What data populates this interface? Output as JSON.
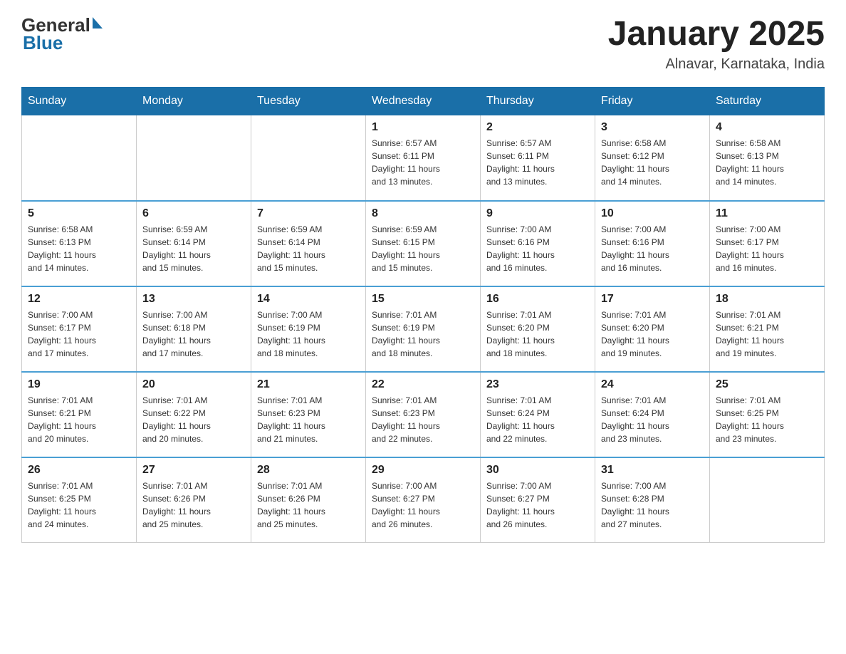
{
  "header": {
    "logo_general": "General",
    "logo_blue": "Blue",
    "title": "January 2025",
    "subtitle": "Alnavar, Karnataka, India"
  },
  "weekdays": [
    "Sunday",
    "Monday",
    "Tuesday",
    "Wednesday",
    "Thursday",
    "Friday",
    "Saturday"
  ],
  "weeks": [
    [
      {
        "day": "",
        "info": ""
      },
      {
        "day": "",
        "info": ""
      },
      {
        "day": "",
        "info": ""
      },
      {
        "day": "1",
        "info": "Sunrise: 6:57 AM\nSunset: 6:11 PM\nDaylight: 11 hours\nand 13 minutes."
      },
      {
        "day": "2",
        "info": "Sunrise: 6:57 AM\nSunset: 6:11 PM\nDaylight: 11 hours\nand 13 minutes."
      },
      {
        "day": "3",
        "info": "Sunrise: 6:58 AM\nSunset: 6:12 PM\nDaylight: 11 hours\nand 14 minutes."
      },
      {
        "day": "4",
        "info": "Sunrise: 6:58 AM\nSunset: 6:13 PM\nDaylight: 11 hours\nand 14 minutes."
      }
    ],
    [
      {
        "day": "5",
        "info": "Sunrise: 6:58 AM\nSunset: 6:13 PM\nDaylight: 11 hours\nand 14 minutes."
      },
      {
        "day": "6",
        "info": "Sunrise: 6:59 AM\nSunset: 6:14 PM\nDaylight: 11 hours\nand 15 minutes."
      },
      {
        "day": "7",
        "info": "Sunrise: 6:59 AM\nSunset: 6:14 PM\nDaylight: 11 hours\nand 15 minutes."
      },
      {
        "day": "8",
        "info": "Sunrise: 6:59 AM\nSunset: 6:15 PM\nDaylight: 11 hours\nand 15 minutes."
      },
      {
        "day": "9",
        "info": "Sunrise: 7:00 AM\nSunset: 6:16 PM\nDaylight: 11 hours\nand 16 minutes."
      },
      {
        "day": "10",
        "info": "Sunrise: 7:00 AM\nSunset: 6:16 PM\nDaylight: 11 hours\nand 16 minutes."
      },
      {
        "day": "11",
        "info": "Sunrise: 7:00 AM\nSunset: 6:17 PM\nDaylight: 11 hours\nand 16 minutes."
      }
    ],
    [
      {
        "day": "12",
        "info": "Sunrise: 7:00 AM\nSunset: 6:17 PM\nDaylight: 11 hours\nand 17 minutes."
      },
      {
        "day": "13",
        "info": "Sunrise: 7:00 AM\nSunset: 6:18 PM\nDaylight: 11 hours\nand 17 minutes."
      },
      {
        "day": "14",
        "info": "Sunrise: 7:00 AM\nSunset: 6:19 PM\nDaylight: 11 hours\nand 18 minutes."
      },
      {
        "day": "15",
        "info": "Sunrise: 7:01 AM\nSunset: 6:19 PM\nDaylight: 11 hours\nand 18 minutes."
      },
      {
        "day": "16",
        "info": "Sunrise: 7:01 AM\nSunset: 6:20 PM\nDaylight: 11 hours\nand 18 minutes."
      },
      {
        "day": "17",
        "info": "Sunrise: 7:01 AM\nSunset: 6:20 PM\nDaylight: 11 hours\nand 19 minutes."
      },
      {
        "day": "18",
        "info": "Sunrise: 7:01 AM\nSunset: 6:21 PM\nDaylight: 11 hours\nand 19 minutes."
      }
    ],
    [
      {
        "day": "19",
        "info": "Sunrise: 7:01 AM\nSunset: 6:21 PM\nDaylight: 11 hours\nand 20 minutes."
      },
      {
        "day": "20",
        "info": "Sunrise: 7:01 AM\nSunset: 6:22 PM\nDaylight: 11 hours\nand 20 minutes."
      },
      {
        "day": "21",
        "info": "Sunrise: 7:01 AM\nSunset: 6:23 PM\nDaylight: 11 hours\nand 21 minutes."
      },
      {
        "day": "22",
        "info": "Sunrise: 7:01 AM\nSunset: 6:23 PM\nDaylight: 11 hours\nand 22 minutes."
      },
      {
        "day": "23",
        "info": "Sunrise: 7:01 AM\nSunset: 6:24 PM\nDaylight: 11 hours\nand 22 minutes."
      },
      {
        "day": "24",
        "info": "Sunrise: 7:01 AM\nSunset: 6:24 PM\nDaylight: 11 hours\nand 23 minutes."
      },
      {
        "day": "25",
        "info": "Sunrise: 7:01 AM\nSunset: 6:25 PM\nDaylight: 11 hours\nand 23 minutes."
      }
    ],
    [
      {
        "day": "26",
        "info": "Sunrise: 7:01 AM\nSunset: 6:25 PM\nDaylight: 11 hours\nand 24 minutes."
      },
      {
        "day": "27",
        "info": "Sunrise: 7:01 AM\nSunset: 6:26 PM\nDaylight: 11 hours\nand 25 minutes."
      },
      {
        "day": "28",
        "info": "Sunrise: 7:01 AM\nSunset: 6:26 PM\nDaylight: 11 hours\nand 25 minutes."
      },
      {
        "day": "29",
        "info": "Sunrise: 7:00 AM\nSunset: 6:27 PM\nDaylight: 11 hours\nand 26 minutes."
      },
      {
        "day": "30",
        "info": "Sunrise: 7:00 AM\nSunset: 6:27 PM\nDaylight: 11 hours\nand 26 minutes."
      },
      {
        "day": "31",
        "info": "Sunrise: 7:00 AM\nSunset: 6:28 PM\nDaylight: 11 hours\nand 27 minutes."
      },
      {
        "day": "",
        "info": ""
      }
    ]
  ]
}
